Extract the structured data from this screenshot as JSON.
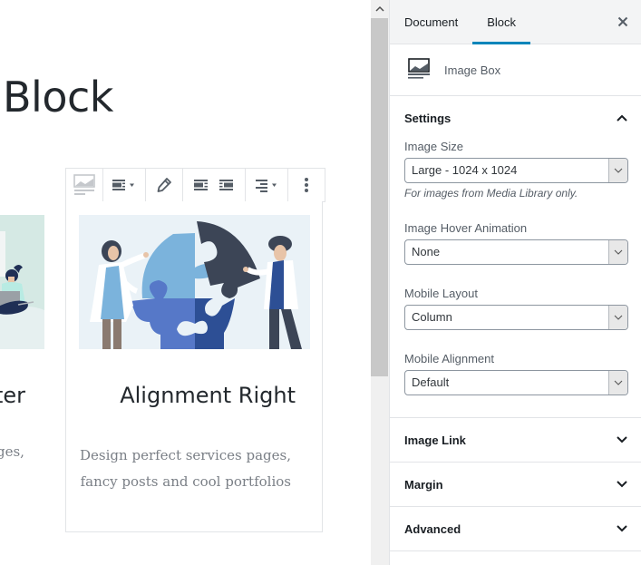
{
  "editor": {
    "page_title": "Block",
    "left_card": {
      "title": "ter",
      "text": "ges,"
    },
    "toolbar": {
      "buttons": [
        {
          "name": "block-type-image-box",
          "icon": "image-box-icon"
        },
        {
          "name": "change-alignment",
          "icon": "align-dropdown-icon"
        },
        {
          "name": "edit",
          "icon": "pencil-icon"
        },
        {
          "name": "media-left",
          "icon": "media-left-icon"
        },
        {
          "name": "media-right",
          "icon": "media-right-icon"
        },
        {
          "name": "text-alignment",
          "icon": "text-align-right-icon"
        },
        {
          "name": "more-options",
          "icon": "more-vertical-icon"
        }
      ]
    },
    "card": {
      "title": "Alignment Right",
      "text": "Design perfect services pages, fancy posts and cool portfolios"
    }
  },
  "sidebar": {
    "tabs": [
      {
        "label": "Document",
        "active": false
      },
      {
        "label": "Block",
        "active": true
      }
    ],
    "close_label": "Close settings",
    "block_name": "Image Box",
    "accent_color": "#0085ba",
    "settings": {
      "title": "Settings",
      "expanded": true,
      "fields": [
        {
          "label": "Image Size",
          "value": "Large - 1024 x 1024",
          "help": "For images from Media Library only."
        },
        {
          "label": "Image Hover Animation",
          "value": "None"
        },
        {
          "label": "Mobile Layout",
          "value": "Column"
        },
        {
          "label": "Mobile Alignment",
          "value": "Default"
        }
      ]
    },
    "panels": [
      {
        "title": "Image Link",
        "expanded": false
      },
      {
        "title": "Margin",
        "expanded": false
      },
      {
        "title": "Advanced",
        "expanded": false
      }
    ]
  }
}
